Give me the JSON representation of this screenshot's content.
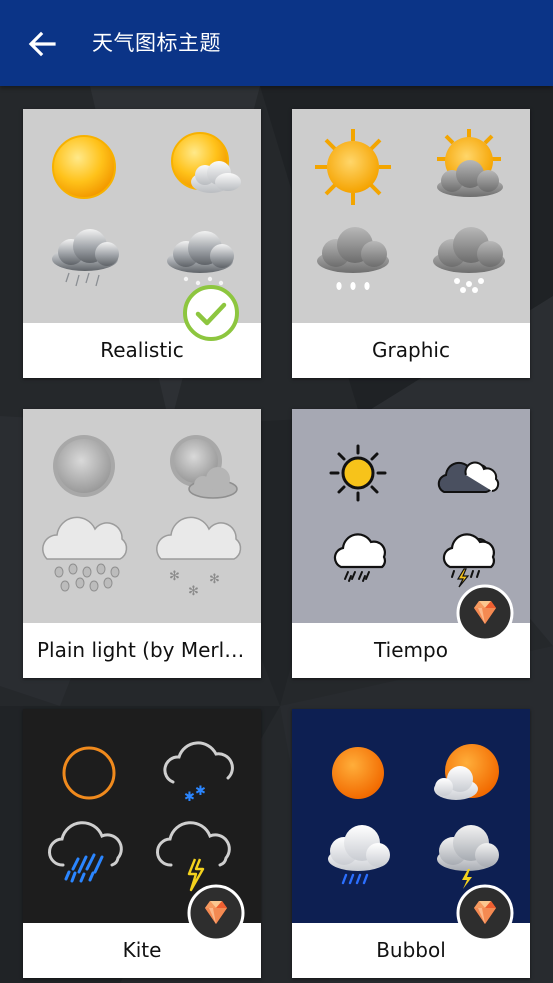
{
  "header": {
    "title": "天气图标主题"
  },
  "themes": [
    {
      "name": "Realistic",
      "selected": true,
      "premium": false,
      "preview_bg": "#cdcdcd"
    },
    {
      "name": "Graphic",
      "selected": false,
      "premium": false,
      "preview_bg": "#cdcdcd"
    },
    {
      "name": "Plain light (by Merli…",
      "selected": false,
      "premium": false,
      "preview_bg": "#cdcdcd"
    },
    {
      "name": "Tiempo",
      "selected": false,
      "premium": true,
      "preview_bg": "#a6a8b3"
    },
    {
      "name": "Kite",
      "selected": false,
      "premium": true,
      "preview_bg": "#1d1d1d"
    },
    {
      "name": "Bubbol",
      "selected": false,
      "premium": true,
      "preview_bg": "#0d1f52"
    }
  ],
  "colors": {
    "app_bar": "#0b3487",
    "background": "#232629",
    "selected_check": "#8dc63f",
    "premium_badge": "#2e2e2e",
    "gem": "#f26b3a"
  },
  "icons": {
    "back": "arrow-left-icon",
    "selected": "checkmark-circle-icon",
    "premium": "diamond-gem-icon"
  }
}
